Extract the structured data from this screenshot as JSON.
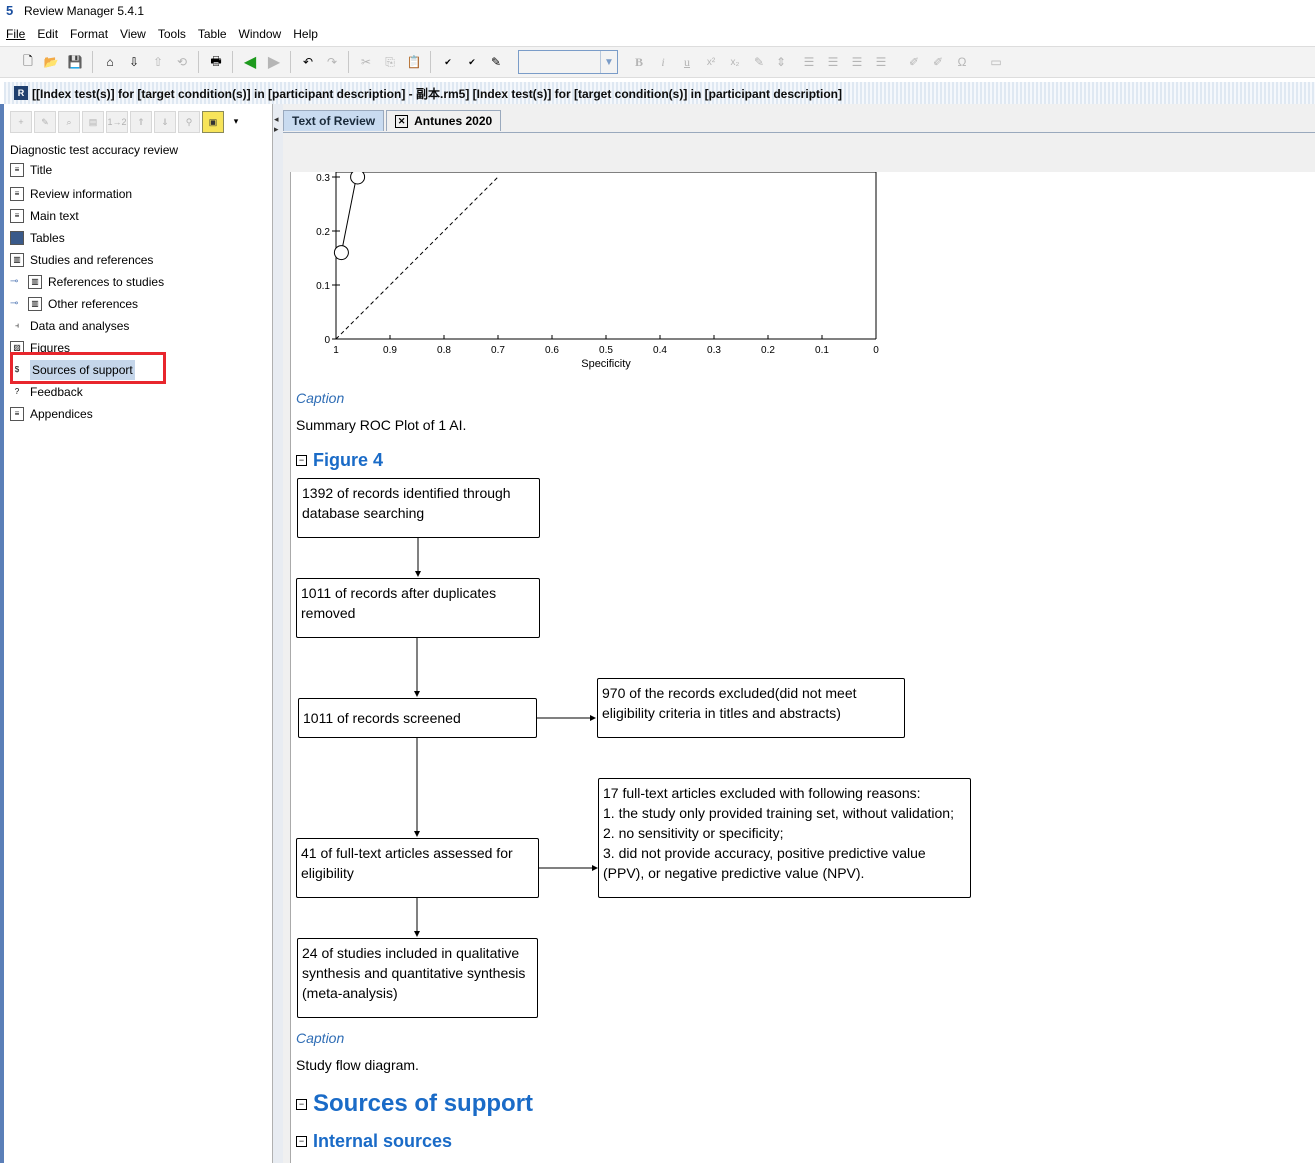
{
  "window": {
    "title": "Review Manager 5.4.1",
    "app_icon": "5"
  },
  "menu": [
    "File",
    "Edit",
    "Format",
    "View",
    "Tools",
    "Table",
    "Window",
    "Help"
  ],
  "toolbar": {
    "icons": [
      "new-file-icon",
      "open-folder-icon",
      "save-icon",
      "home-icon",
      "download-icon",
      "upload-icon",
      "import-icon",
      "print-icon",
      "back-green-arrow-icon",
      "forward-arrow-icon",
      "undo-icon",
      "redo-icon",
      "cut-icon",
      "copy-icon",
      "paste-icon",
      "spellcheck-icon",
      "spellcheck-abc-icon",
      "highlight-icon"
    ],
    "format_icons": [
      "B",
      "i",
      "u",
      "x²",
      "x₂",
      "✎",
      "⇕",
      "☰",
      "☰",
      "☰",
      "☰",
      "✐",
      "✐",
      "Ω",
      "▭"
    ],
    "font_combo_value": ""
  },
  "document_bar": {
    "title": "[[Index test(s)] for [target condition(s)] in [participant description] - 副本.rm5] [Index test(s)] for [target condition(s)] in [participant description]"
  },
  "tree": {
    "root": "Diagnostic test accuracy review",
    "items": [
      {
        "label": "Title",
        "icon": "page-icon"
      },
      {
        "label": "Review information",
        "icon": "info-page-icon"
      },
      {
        "label": "Main text",
        "icon": "text-page-icon"
      },
      {
        "label": "Tables",
        "icon": "table-icon"
      },
      {
        "label": "Studies and references",
        "icon": "book-icon"
      },
      {
        "label": "References to studies",
        "icon": "books-icon"
      },
      {
        "label": "Other references",
        "icon": "book-icon"
      },
      {
        "label": "Data and analyses",
        "icon": "chart-icon"
      },
      {
        "label": "Figures",
        "icon": "figure-icon"
      },
      {
        "label": "Sources of support",
        "icon": "money-icon"
      },
      {
        "label": "Feedback",
        "icon": "feedback-icon"
      },
      {
        "label": "Appendices",
        "icon": "appendix-icon"
      }
    ]
  },
  "tabs": [
    {
      "label": "Text of Review",
      "active": true
    },
    {
      "label": "Antunes 2020",
      "active": false
    }
  ],
  "chart_data": {
    "type": "scatter",
    "xlabel": "Specificity",
    "ylabel": "",
    "x_ticks": [
      "1",
      "0.9",
      "0.8",
      "0.7",
      "0.6",
      "0.5",
      "0.4",
      "0.3",
      "0.2",
      "0.1",
      "0"
    ],
    "y_ticks": [
      "0",
      "0.1",
      "0.2",
      "0.3"
    ],
    "xlim": [
      1,
      0
    ],
    "points": [
      {
        "x": 0.99,
        "y": 0.16
      },
      {
        "x": 0.96,
        "y": 0.3
      }
    ],
    "reference_line": "diagonal dashed"
  },
  "content": {
    "caption_label": "Caption",
    "figure3_caption": "Summary ROC Plot of 1 AI.",
    "figure4_heading": "Figure 4",
    "flow": {
      "identified": "1392 of records identified through database searching",
      "after_duplicates": "1011 of records after duplicates removed",
      "screened": "1011 of records screened",
      "excluded": "970 of the records excluded(did not meet eligibility criteria in titles and abstracts)",
      "assessed": "41 of full-text articles assessed for eligibility",
      "fulltext_excluded_title": "17 full-text articles excluded with following reasons:",
      "reason1": "1. the study only provided training set, without validation;",
      "reason2": "2. no sensitivity or specificity;",
      "reason3": "3. did not provide accuracy, positive predictive value (PPV), or negative predictive value (NPV).",
      "included": "24 of studies included in qualitative synthesis and quantitative synthesis (meta-analysis)"
    },
    "figure4_caption": "Study flow diagram.",
    "sources_heading": "Sources of support",
    "internal_heading": "Internal sources"
  },
  "colors": {
    "heading_blue": "#1a6bc7",
    "caption_blue": "#2f6db5",
    "highlight_red": "#e8262d",
    "selection": "#c5d6ea"
  }
}
